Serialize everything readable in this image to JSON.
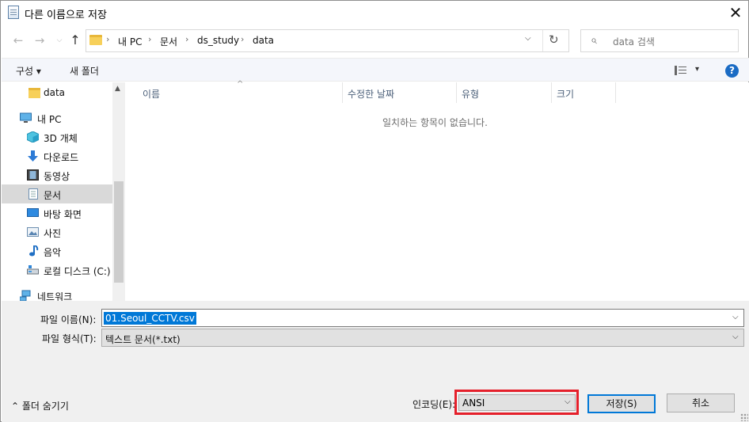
{
  "window": {
    "title": "다른 이름으로 저장",
    "close_glyph": "✕"
  },
  "nav": {
    "back": "←",
    "forward": "→",
    "up": "↑"
  },
  "address": {
    "crumbs": [
      "내 PC",
      "문서",
      "ds_study",
      "data"
    ],
    "separator": "›",
    "dropdown": "⌵",
    "refresh": "↻"
  },
  "search": {
    "placeholder": "data 검색",
    "icon": "⌕"
  },
  "toolbar": {
    "organize": "구성 ▾",
    "new_folder": "새 폴더",
    "view_dd": "▾",
    "help": "?"
  },
  "tree": {
    "items": [
      {
        "label": "data",
        "icon": "folder-icon"
      },
      {
        "label": "내 PC",
        "icon": "pc-icon"
      },
      {
        "label": "3D 개체",
        "icon": "cube-icon"
      },
      {
        "label": "다운로드",
        "icon": "download-icon"
      },
      {
        "label": "동영상",
        "icon": "video-icon"
      },
      {
        "label": "문서",
        "icon": "document-icon",
        "selected": true
      },
      {
        "label": "바탕 화면",
        "icon": "desktop-icon"
      },
      {
        "label": "사진",
        "icon": "pictures-icon"
      },
      {
        "label": "음악",
        "icon": "music-icon"
      },
      {
        "label": "로컬 디스크 (C:)",
        "icon": "drive-icon"
      },
      {
        "label": "네트워크",
        "icon": "network-icon"
      }
    ],
    "scroll_up": "▲"
  },
  "list": {
    "columns": [
      "이름",
      "수정한 날짜",
      "유형",
      "크기"
    ],
    "sort_glyph": "^",
    "empty_message": "일치하는 항목이 없습니다."
  },
  "form": {
    "filename_label": "파일 이름(N):",
    "filename_value": "01.Seoul_CCTV.csv",
    "filetype_label": "파일 형식(T):",
    "filetype_value": "텍스트 문서(*.txt)",
    "dd_glyph": "⌵"
  },
  "footer": {
    "hide_folders": "⌃  폴더 숨기기",
    "encoding_label": "인코딩(E):",
    "encoding_value": "ANSI",
    "save": "저장(S)",
    "cancel": "취소"
  },
  "colors": {
    "accent": "#0078d7",
    "highlight_border": "#e5202b",
    "selected_tree": "#d9d9d9"
  }
}
